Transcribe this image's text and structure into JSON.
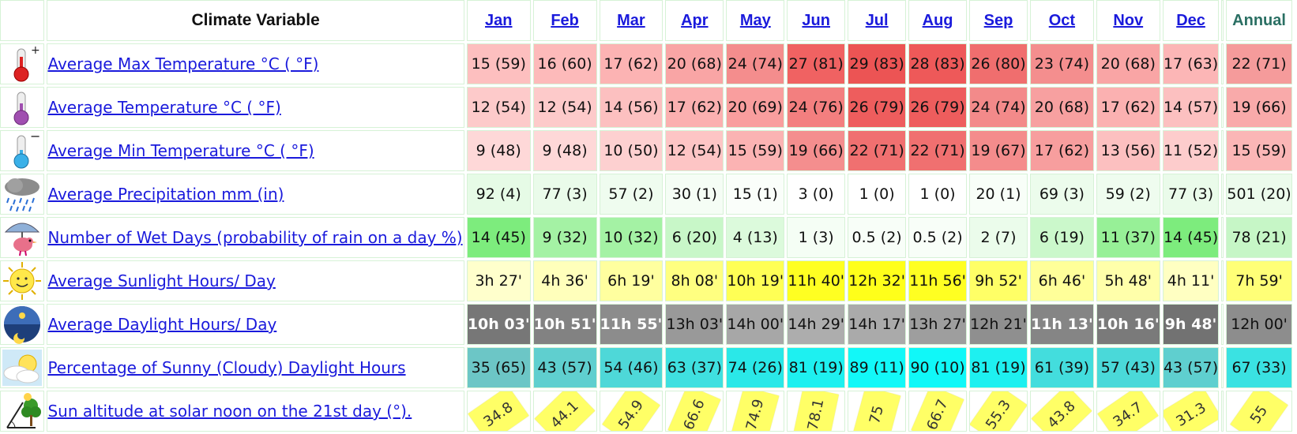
{
  "header": {
    "variable_label": "Climate Variable",
    "months": [
      "Jan",
      "Feb",
      "Mar",
      "Apr",
      "May",
      "Jun",
      "Jul",
      "Aug",
      "Sep",
      "Oct",
      "Nov",
      "Dec"
    ],
    "annual_label": "Annual"
  },
  "rows": [
    {
      "label": "Average Max Temperature °C ( °F)",
      "icon": "thermometer-hot-icon",
      "values": [
        "15 (59)",
        "16 (60)",
        "17 (62)",
        "20 (68)",
        "24 (74)",
        "27 (81)",
        "29 (83)",
        "28 (83)",
        "26 (80)",
        "23 (74)",
        "20 (68)",
        "17 (63)"
      ],
      "colors": [
        "#fdbfbf",
        "#fdbaba",
        "#fcb3b3",
        "#f9a5a5",
        "#f48d8d",
        "#f06262",
        "#ec5454",
        "#ee5959",
        "#f06e6e",
        "#f48e8e",
        "#f9a5a5",
        "#fcb6b6"
      ],
      "annual": "22 (71)",
      "annual_color": "#f59b9b"
    },
    {
      "label": "Average Temperature °C ( °F)",
      "icon": "thermometer-mean-icon",
      "values": [
        "12 (54)",
        "12 (54)",
        "14 (56)",
        "17 (62)",
        "20 (69)",
        "24 (76)",
        "26 (79)",
        "26 (79)",
        "24 (74)",
        "20 (68)",
        "17 (62)",
        "14 (57)"
      ],
      "colors": [
        "#fdcaca",
        "#fdcaca",
        "#fcc0c0",
        "#fbb0b0",
        "#f99e9e",
        "#f37f7f",
        "#ee5d5d",
        "#ee5d5d",
        "#f38a8a",
        "#f7a0a0",
        "#fbb1b1",
        "#fcc0c0"
      ],
      "annual": "19 (66)",
      "annual_color": "#f9aaaa"
    },
    {
      "label": "Average Min Temperature °C ( °F)",
      "icon": "thermometer-cold-icon",
      "values": [
        "9 (48)",
        "9 (48)",
        "10 (50)",
        "12 (54)",
        "15 (59)",
        "19 (66)",
        "22 (71)",
        "22 (71)",
        "19 (67)",
        "17 (62)",
        "13 (56)",
        "11 (52)"
      ],
      "colors": [
        "#fed8d8",
        "#fed8d8",
        "#fdd0d0",
        "#fdc5c5",
        "#fbb3b3",
        "#f48e8e",
        "#f07070",
        "#f07070",
        "#f48c8c",
        "#f79e9e",
        "#fcc0c0",
        "#fdcccc"
      ],
      "annual": "15 (59)",
      "annual_color": "#fbb6b6"
    },
    {
      "label": "Average Precipitation mm (in)",
      "icon": "rain-cloud-icon",
      "values": [
        "92 (4)",
        "77 (3)",
        "57 (2)",
        "30 (1)",
        "15 (1)",
        "3 (0)",
        "1 (0)",
        "1 (0)",
        "20 (1)",
        "69 (3)",
        "59 (2)",
        "77 (3)"
      ],
      "colors": [
        "#e6fbe6",
        "#eafbea",
        "#effcef",
        "#f5fdf5",
        "#fafefa",
        "#ffffff",
        "#ffffff",
        "#ffffff",
        "#f8fef8",
        "#ecfcec",
        "#effcef",
        "#eafbea"
      ],
      "annual": "501 (20)",
      "annual_color": "#ecfbec"
    },
    {
      "label": "Number of Wet Days (probability of rain on a day %)",
      "icon": "bird-umbrella-icon",
      "values": [
        "14 (45)",
        "9 (32)",
        "10 (32)",
        "6 (20)",
        "4 (13)",
        "1 (3)",
        "0.5 (2)",
        "0.5 (2)",
        "2 (7)",
        "6 (19)",
        "11 (37)",
        "14 (45)"
      ],
      "colors": [
        "#7dec7d",
        "#a4f2a4",
        "#a4f2a4",
        "#c8f7c8",
        "#dcfadc",
        "#f5fef5",
        "#f8fef8",
        "#f8fef8",
        "#ebfceb",
        "#cbf8cb",
        "#97f097",
        "#7dec7d"
      ],
      "annual": "78 (21)",
      "annual_color": "#c6f6c6"
    },
    {
      "label": "Average Sunlight Hours/ Day",
      "icon": "sun-face-icon",
      "values": [
        "3h 27'",
        "4h 36'",
        "6h 19'",
        "8h 08'",
        "10h 19'",
        "11h 40'",
        "12h 32'",
        "11h 56'",
        "9h 52'",
        "6h 46'",
        "5h 48'",
        "4h 11'"
      ],
      "colors": [
        "#ffffcc",
        "#ffffbb",
        "#ffff9f",
        "#ffff80",
        "#ffff55",
        "#ffff22",
        "#ffff1a",
        "#ffff22",
        "#ffff66",
        "#ffff99",
        "#ffffaa",
        "#ffffc2"
      ],
      "annual": "7h 59'",
      "annual_color": "#ffff77"
    },
    {
      "label": "Average Daylight Hours/ Day",
      "icon": "daylight-moon-icon",
      "values": [
        "10h 03'",
        "10h 51'",
        "11h 55'",
        "13h 03'",
        "14h 00'",
        "14h 29'",
        "14h 17'",
        "13h 27'",
        "12h 21'",
        "11h 13'",
        "10h 16'",
        "9h 48'"
      ],
      "colors": [
        "#777777",
        "#828282",
        "#8c8c8c",
        "#999999",
        "#a7a7a7",
        "#adadad",
        "#aaaaaa",
        "#9e9e9e",
        "#8f8f8f",
        "#858585",
        "#7a7a7a",
        "#727272"
      ],
      "text_dark": [
        true,
        true,
        true,
        false,
        false,
        false,
        false,
        false,
        false,
        true,
        true,
        true
      ],
      "annual": "12h 00'",
      "annual_color": "#8d8d8d"
    },
    {
      "label": "Percentage of Sunny (Cloudy) Daylight Hours",
      "icon": "sun-cloud-icon",
      "values": [
        "35 (65)",
        "43 (57)",
        "54 (46)",
        "63 (37)",
        "74 (26)",
        "81 (19)",
        "89 (11)",
        "90 (10)",
        "81 (19)",
        "61 (39)",
        "57 (43)",
        "43 (57)"
      ],
      "colors": [
        "#6cc6c6",
        "#5fcfcf",
        "#4ed8d8",
        "#3fe0e0",
        "#2ae8e8",
        "#1ef0f0",
        "#12f8f8",
        "#10f8f8",
        "#1ef0f0",
        "#43dddd",
        "#4ad9d9",
        "#5fcfcf"
      ],
      "annual": "67 (33)",
      "annual_color": "#3ae2e2"
    },
    {
      "label": "Sun altitude at solar noon on the 21st day (°).",
      "icon": "sun-altitude-icon",
      "values": [
        "34.8",
        "44.1",
        "54.9",
        "66.6",
        "74.9",
        "78.1",
        "75",
        "66.7",
        "55.3",
        "43.8",
        "34.7",
        "31.3"
      ],
      "angles": [
        34.8,
        44.1,
        54.9,
        66.6,
        74.9,
        78.1,
        75,
        66.7,
        55.3,
        43.8,
        34.7,
        31.3
      ],
      "annual": "55",
      "annual_angle": 55
    }
  ]
}
